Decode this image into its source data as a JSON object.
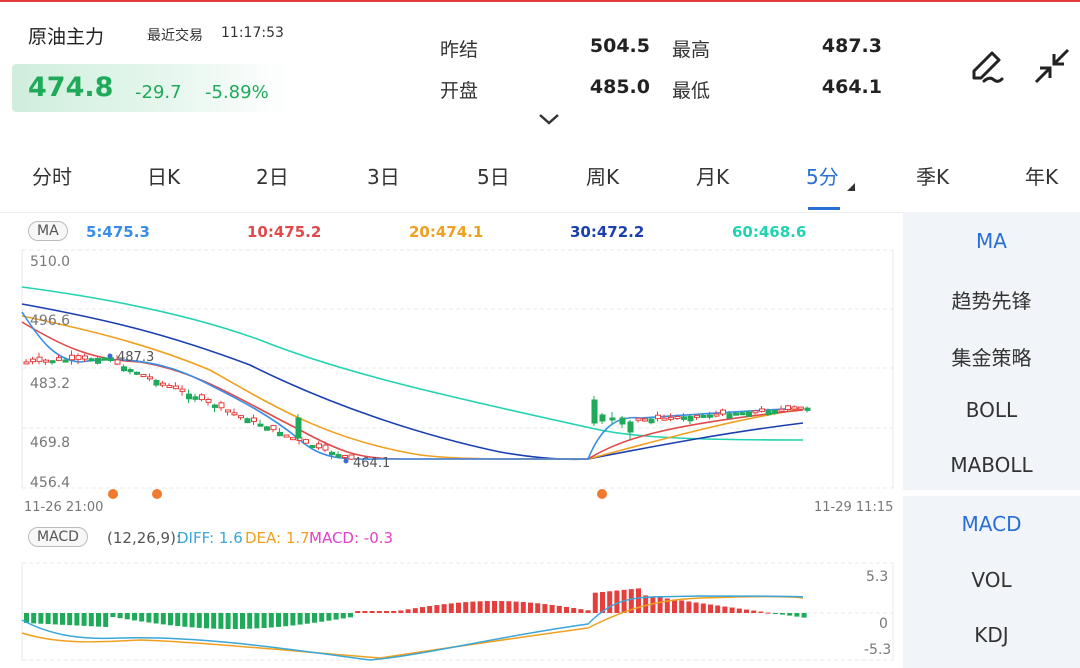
{
  "header": {
    "name": "原油主力",
    "trade_label": "最近交易",
    "trade_time": "11:17:53",
    "price": "474.8",
    "change": "-29.7",
    "change_pct": "-5.89%",
    "stats": [
      {
        "label": "昨结",
        "value": "504.5"
      },
      {
        "label": "开盘",
        "value": "485.0"
      },
      {
        "label": "最高",
        "value": "487.3"
      },
      {
        "label": "最低",
        "value": "464.1"
      }
    ],
    "icons": [
      "pen-icon",
      "collapse-icon",
      "chevron-down-icon"
    ]
  },
  "tabs": [
    "分时",
    "日K",
    "2日",
    "3日",
    "5日",
    "周K",
    "月K",
    "5分",
    "季K",
    "年K"
  ],
  "active_tab": "5分",
  "main_panel": {
    "badge": "MA",
    "ma_legend": [
      {
        "label": "5:475.3",
        "color": "#3a8ee6"
      },
      {
        "label": "10:475.2",
        "color": "#e04a4a"
      },
      {
        "label": "20:474.1",
        "color": "#f0a020"
      },
      {
        "label": "30:472.2",
        "color": "#1a3fb0"
      },
      {
        "label": "60:468.6",
        "color": "#22d3b0"
      }
    ],
    "y_ticks": [
      "510.0",
      "496.6",
      "483.2",
      "469.8",
      "456.4"
    ],
    "high_label": "487.3",
    "low_label": "464.1",
    "x_start": "11-26 21:00",
    "x_end": "11-29 11:15"
  },
  "macd_panel": {
    "badge": "MACD",
    "params": "(12,26,9):",
    "diff": "DIFF: 1.6",
    "dea": "DEA: 1.7",
    "macd": "MACD: -0.3",
    "y_ticks": [
      "5.3",
      "0",
      "-5.3"
    ]
  },
  "right_menu_top": [
    "MA",
    "趋势先锋",
    "集金策略",
    "BOLL",
    "MABOLL"
  ],
  "right_menu_bottom": [
    "MACD",
    "VOL",
    "KDJ"
  ],
  "colors": {
    "up": "#e63d3d",
    "down": "#1faa5a",
    "accent": "#2a6fd6"
  }
}
